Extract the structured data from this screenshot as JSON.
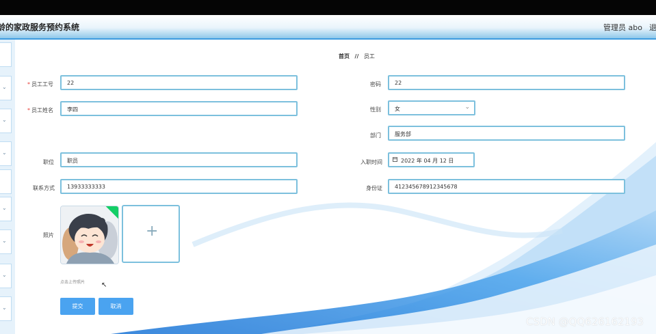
{
  "header": {
    "app_title": "龄的家政服务预约系统",
    "user_label": "管理员 abo",
    "logout_label": "退"
  },
  "sidebar": {
    "items": [
      {
        "icon": "chevron-down-icon"
      },
      {
        "icon": "chevron-down-icon"
      },
      {
        "icon": "chevron-down-icon"
      },
      {
        "icon": "chevron-down-icon"
      },
      {
        "icon": "chevron-down-icon"
      },
      {
        "icon": "chevron-down-icon"
      },
      {
        "icon": "chevron-down-icon"
      },
      {
        "icon": "chevron-down-icon"
      },
      {
        "icon": "chevron-down-icon"
      }
    ]
  },
  "breadcrumb": {
    "home": "首页",
    "separator": "//",
    "current": "员工"
  },
  "form": {
    "required_mark": "*",
    "employee_no": {
      "label": "员工工号",
      "value": "22"
    },
    "password": {
      "label": "密码",
      "value": "22"
    },
    "employee_name": {
      "label": "员工姓名",
      "value": "李四"
    },
    "gender": {
      "label": "性别",
      "value": "女"
    },
    "department": {
      "label": "部门",
      "value": "服务部"
    },
    "position": {
      "label": "职位",
      "value": "职员"
    },
    "hire_date": {
      "label": "入职时间",
      "value": "2022 年 04 月 12 日"
    },
    "phone": {
      "label": "联系方式",
      "value": "13933333333"
    },
    "id_card": {
      "label": "身份证",
      "value": "412345678912345678"
    },
    "photo": {
      "label": "照片",
      "hint": "点击上传照片"
    },
    "submit_label": "提交",
    "cancel_label": "取消"
  },
  "watermark": "CSDN @QQ626162193",
  "colors": {
    "accent": "#4aa3f0",
    "input_border": "#7cc0dd",
    "header_border": "#3d9be0",
    "success_badge": "#13ce66"
  }
}
